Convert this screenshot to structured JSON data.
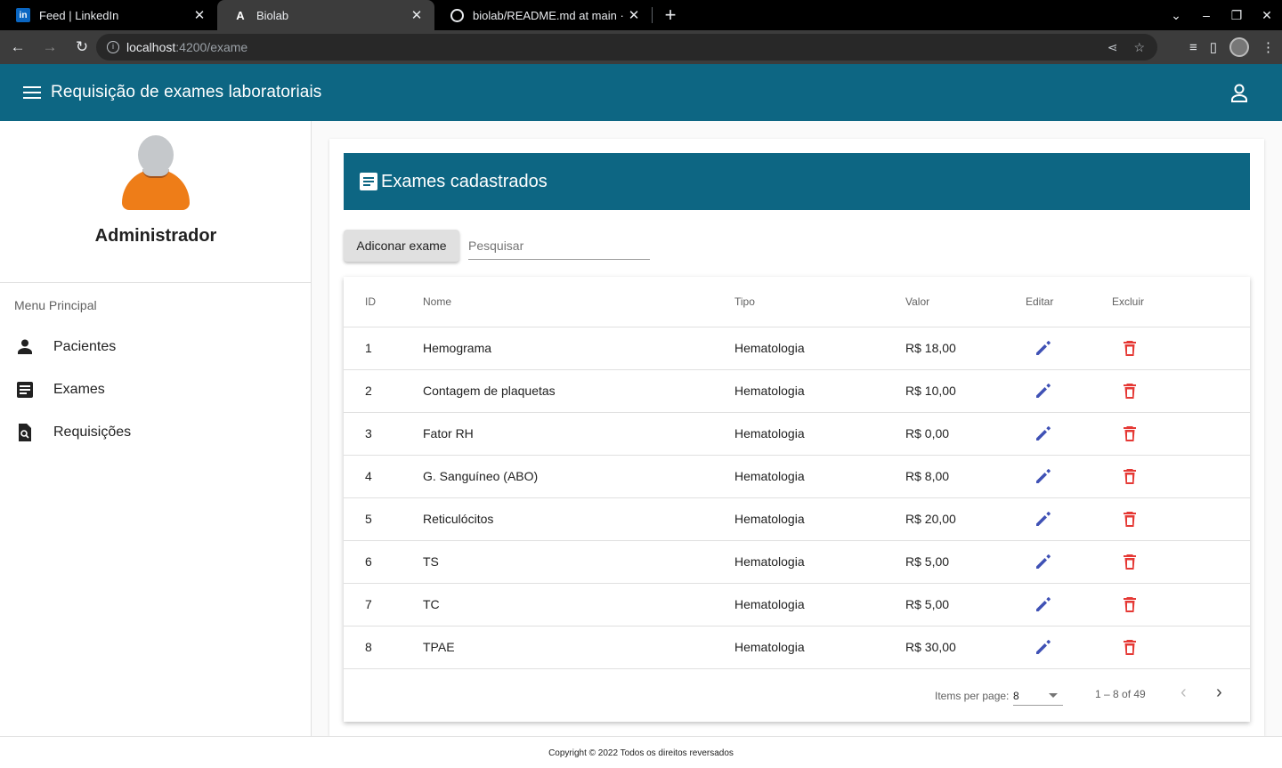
{
  "browser": {
    "tabs": [
      {
        "title": "Feed | LinkedIn",
        "icon": "linkedin-icon",
        "active": false
      },
      {
        "title": "Biolab",
        "icon": "angular-icon",
        "active": true
      },
      {
        "title": "biolab/README.md at main · g",
        "icon": "github-icon",
        "active": false
      }
    ],
    "url_host": "localhost",
    "url_path": ":4200/exame"
  },
  "appbar": {
    "title": "Requisição de exames laboratoriais"
  },
  "sidebar": {
    "profile_name": "Administrador",
    "menu_heading": "Menu Principal",
    "items": [
      {
        "label": "Pacientes",
        "icon": "person-icon"
      },
      {
        "label": "Exames",
        "icon": "document-icon"
      },
      {
        "label": "Requisições",
        "icon": "search-document-icon"
      }
    ]
  },
  "main": {
    "header_title": "Exames cadastrados",
    "add_button": "Adiconar exame",
    "search_placeholder": "Pesquisar",
    "columns": [
      "ID",
      "Nome",
      "Tipo",
      "Valor",
      "Editar",
      "Excluir"
    ],
    "rows": [
      {
        "id": "1",
        "nome": "Hemograma",
        "tipo": "Hematologia",
        "valor": "R$ 18,00"
      },
      {
        "id": "2",
        "nome": "Contagem de plaquetas",
        "tipo": "Hematologia",
        "valor": "R$ 10,00"
      },
      {
        "id": "3",
        "nome": "Fator RH",
        "tipo": "Hematologia",
        "valor": "R$ 0,00"
      },
      {
        "id": "4",
        "nome": "G. Sanguíneo (ABO)",
        "tipo": "Hematologia",
        "valor": "R$ 8,00"
      },
      {
        "id": "5",
        "nome": "Reticulócitos",
        "tipo": "Hematologia",
        "valor": "R$ 20,00"
      },
      {
        "id": "6",
        "nome": "TS",
        "tipo": "Hematologia",
        "valor": "R$ 5,00"
      },
      {
        "id": "7",
        "nome": "TC",
        "tipo": "Hematologia",
        "valor": "R$ 5,00"
      },
      {
        "id": "8",
        "nome": "TPAE",
        "tipo": "Hematologia",
        "valor": "R$ 30,00"
      }
    ],
    "paginator": {
      "label": "Items per page:",
      "page_size": "8",
      "range": "1 – 8 of 49"
    }
  },
  "footer": {
    "text": "Copyright © 2022 Todos os direitos reversados"
  },
  "colors": {
    "primary": "#0d6683",
    "edit": "#3f51b5",
    "delete": "#e53935",
    "avatar_body": "#ee7d18"
  }
}
